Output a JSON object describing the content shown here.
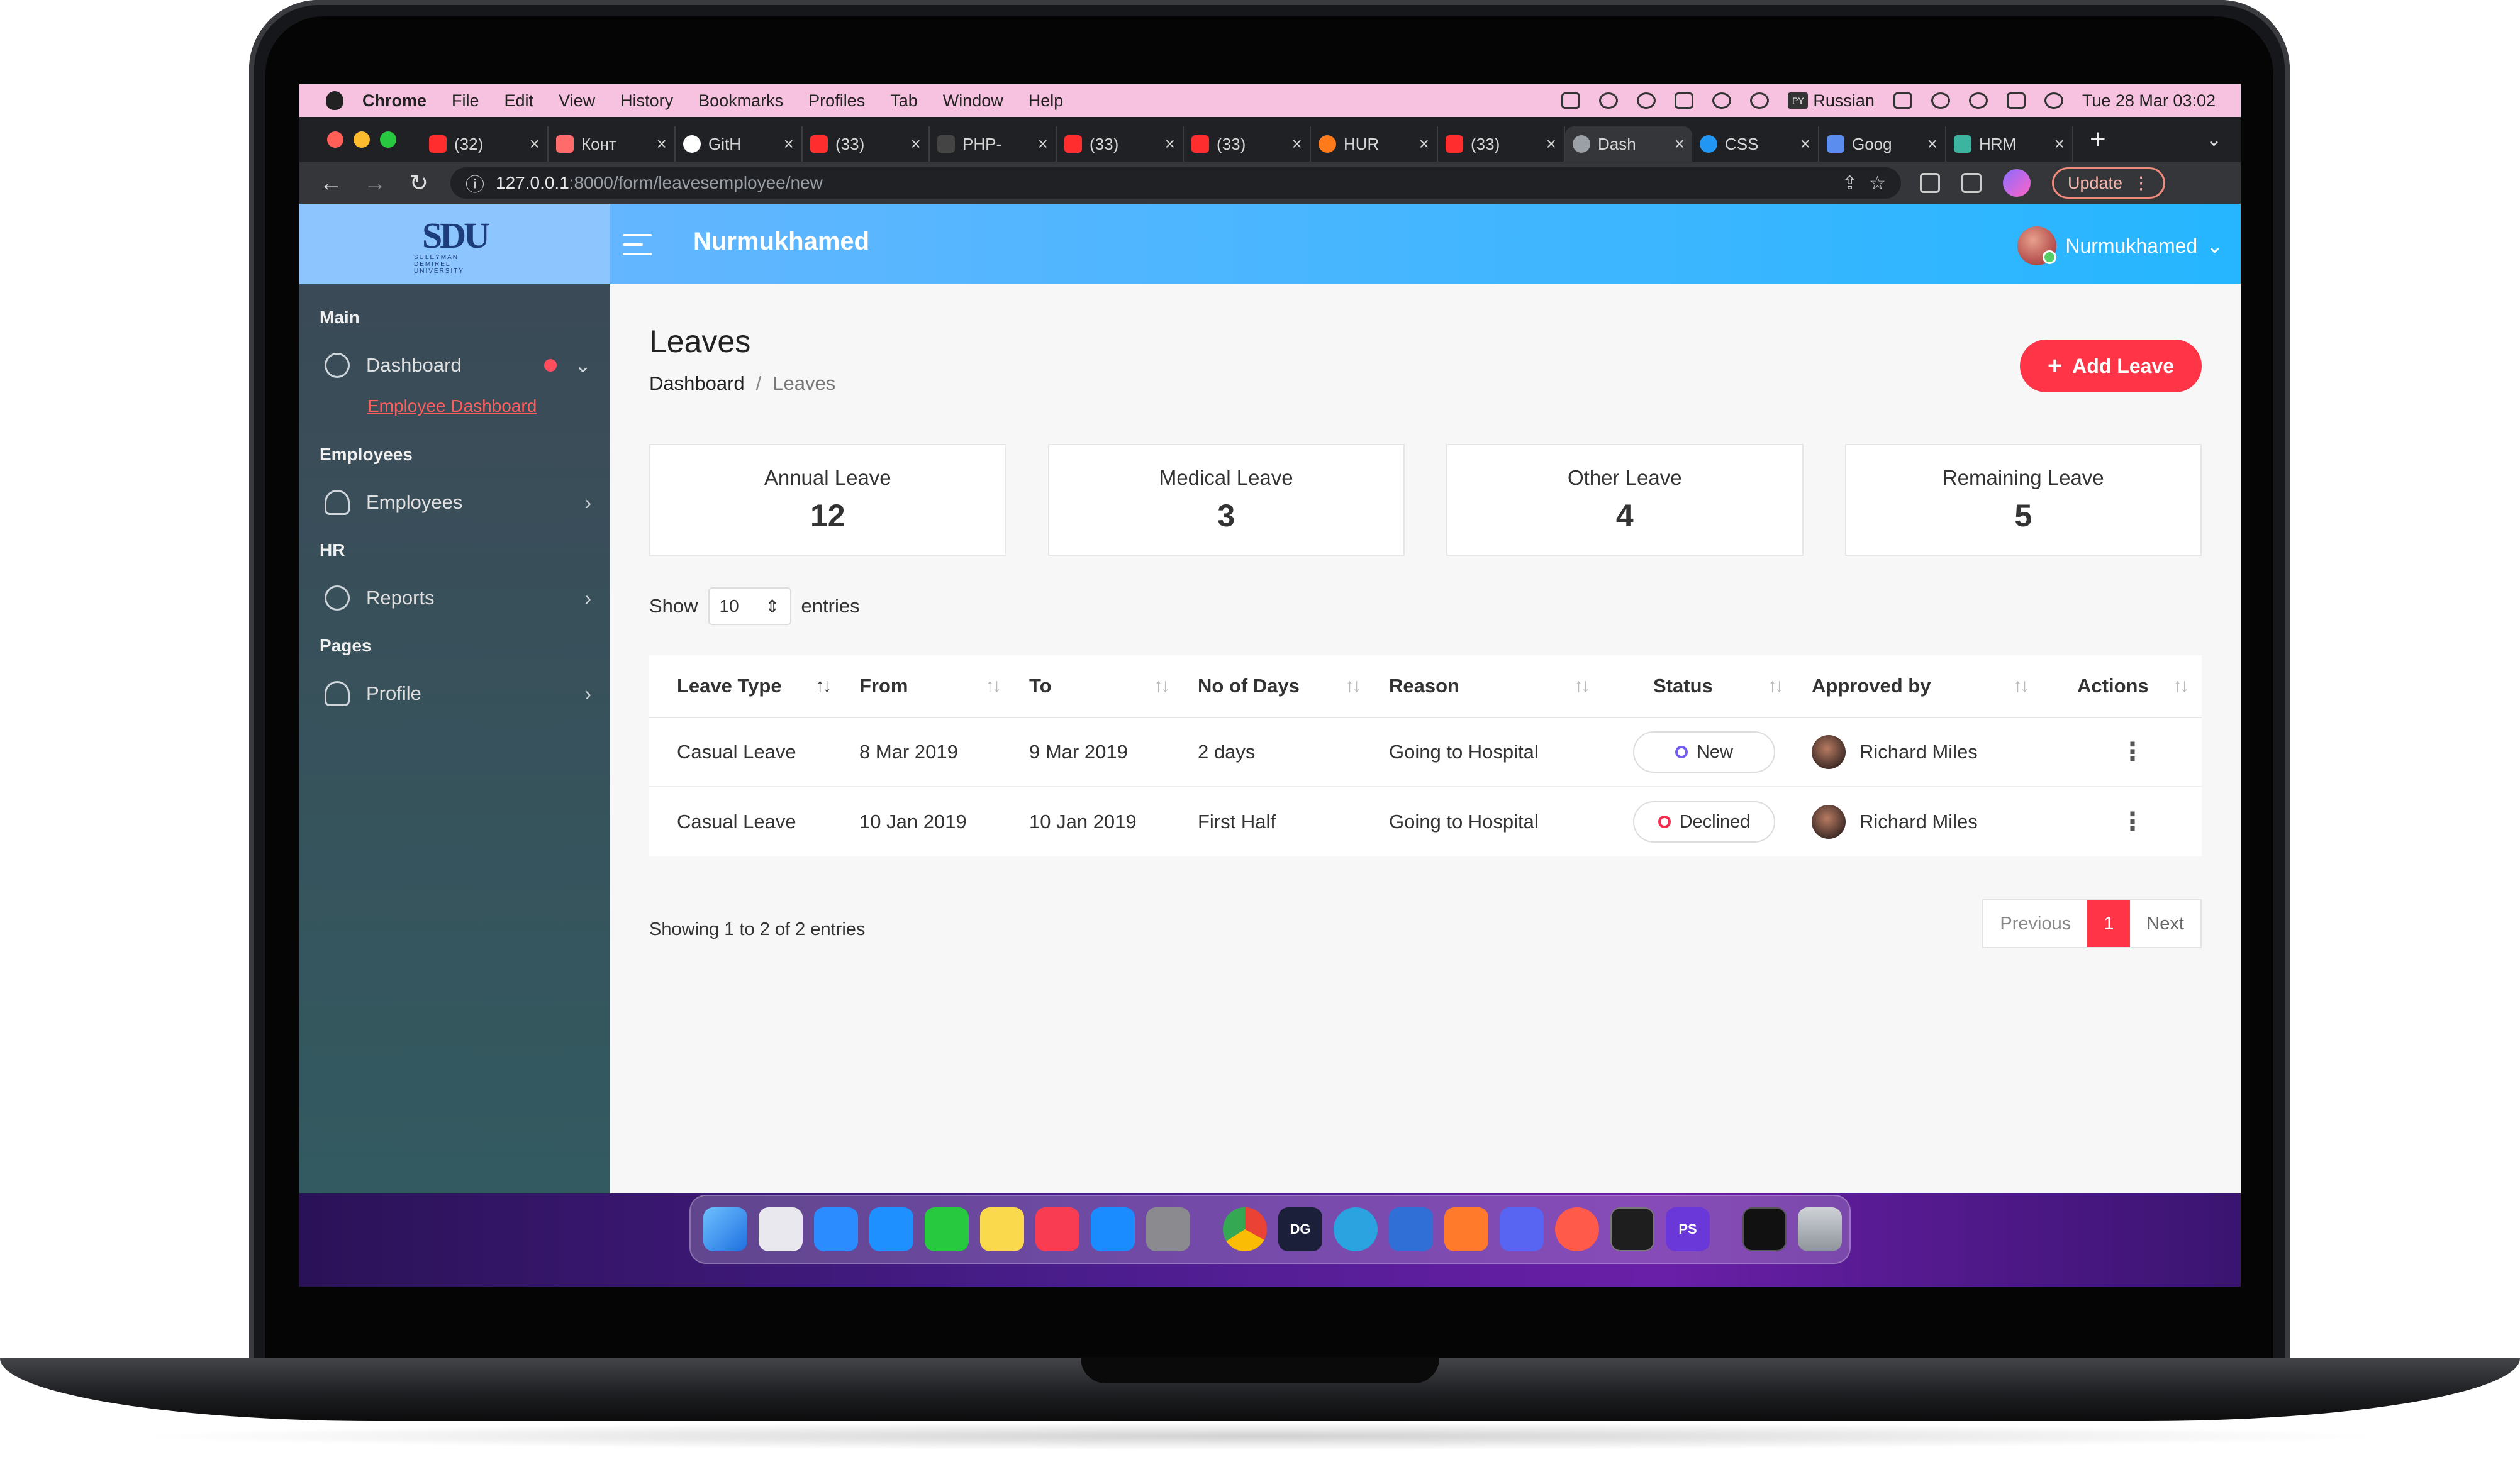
{
  "menubar": {
    "app": "Chrome",
    "items": [
      "File",
      "Edit",
      "View",
      "History",
      "Bookmarks",
      "Profiles",
      "Tab",
      "Window",
      "Help"
    ],
    "language": "Russian",
    "clock": "Tue 28 Mar  03:02"
  },
  "tabs": [
    {
      "label": "(32)",
      "color": "#ff2d2d"
    },
    {
      "label": "Конт",
      "color": "#ff6b6b"
    },
    {
      "label": "GitH",
      "color": "#ffffff"
    },
    {
      "label": "(33)",
      "color": "#ff2d2d"
    },
    {
      "label": "PHP-",
      "color": "#444444"
    },
    {
      "label": "(33)",
      "color": "#ff2d2d"
    },
    {
      "label": "(33)",
      "color": "#ff2d2d"
    },
    {
      "label": "HUR",
      "color": "#ff7a1a"
    },
    {
      "label": "(33)",
      "color": "#ff2d2d"
    },
    {
      "label": "Dash",
      "color": "#9aa0a6",
      "active": true
    },
    {
      "label": "CSS",
      "color": "#2196f3"
    },
    {
      "label": "Goog",
      "color": "#5b8def"
    },
    {
      "label": "HRM",
      "color": "#3cb4a0"
    }
  ],
  "browser": {
    "url_host": "127.0.0.1",
    "url_path": ":8000/form/leavesemployee/new",
    "update_label": "Update"
  },
  "app": {
    "title": "Nurmukhamed",
    "user_name": "Nurmukhamed",
    "logo_mark": "SDU",
    "logo_sub": "SULEYMAN DEMIREL UNIVERSITY"
  },
  "sidebar": {
    "sections": [
      {
        "title": "Main",
        "items": [
          {
            "label": "Dashboard",
            "icon": "dashboard-icon"
          }
        ],
        "sublinks": [
          "Employee Dashboard"
        ]
      },
      {
        "title": "Employees",
        "items": [
          {
            "label": "Employees",
            "icon": "user-icon"
          }
        ]
      },
      {
        "title": "HR",
        "items": [
          {
            "label": "Reports",
            "icon": "pie-chart-icon"
          }
        ]
      },
      {
        "title": "Pages",
        "items": [
          {
            "label": "Profile",
            "icon": "user-icon"
          }
        ]
      }
    ]
  },
  "page": {
    "title": "Leaves",
    "breadcrumb": [
      "Dashboard",
      "Leaves"
    ],
    "add_button": "Add Leave"
  },
  "stats": [
    {
      "label": "Annual Leave",
      "value": "12"
    },
    {
      "label": "Medical Leave",
      "value": "3"
    },
    {
      "label": "Other Leave",
      "value": "4"
    },
    {
      "label": "Remaining Leave",
      "value": "5"
    }
  ],
  "table": {
    "show_label": "Show",
    "entries_value": "10",
    "entries_label": "entries",
    "columns": [
      "Leave Type",
      "From",
      "To",
      "No of Days",
      "Reason",
      "Status",
      "Approved by",
      "Actions"
    ],
    "rows": [
      {
        "type": "Casual Leave",
        "from": "8 Mar 2019",
        "to": "9 Mar 2019",
        "days": "2 days",
        "reason": "Going to Hospital",
        "status": "New",
        "status_color": "#7460ee",
        "approver": "Richard Miles"
      },
      {
        "type": "Casual Leave",
        "from": "10 Jan 2019",
        "to": "10 Jan 2019",
        "days": "First Half",
        "reason": "Going to Hospital",
        "status": "Declined",
        "status_color": "#f62d51",
        "approver": "Richard Miles"
      }
    ],
    "info": "Showing 1 to 2 of 2 entries",
    "pager": {
      "previous": "Previous",
      "current": "1",
      "next": "Next"
    }
  },
  "colors": {
    "accent": "#ff3547",
    "header_start": "#6fb6ff",
    "header_end": "#25b6ff",
    "sidebar": "#3b4a57"
  }
}
